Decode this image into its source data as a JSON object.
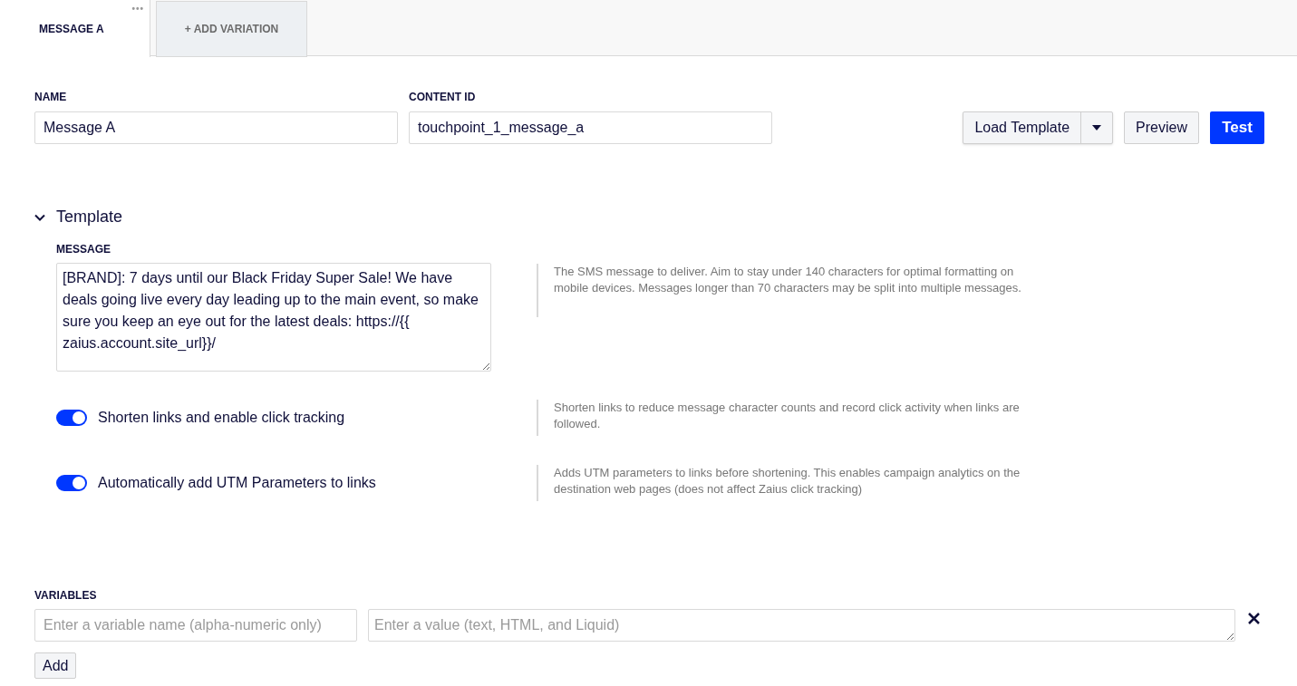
{
  "tabs": [
    {
      "label": "MESSAGE A",
      "selected": true,
      "menu": "•••"
    },
    {
      "label": "+ ADD VARIATION",
      "selected": false
    }
  ],
  "fields": [
    {
      "label": "NAME",
      "value": "Message A"
    },
    {
      "label": "CONTENT ID",
      "value": "touchpoint_1_message_a"
    }
  ],
  "actions": {
    "load_template": "Load Template",
    "preview": "Preview",
    "test": "Test"
  },
  "template": {
    "title": "Template",
    "expanded": true,
    "message_label": "MESSAGE",
    "message": "[BRAND]: 7 days until our Black Friday Super Sale! We have deals going live every day leading up to the main event, so make sure you keep an eye out for the latest deals: https://{{ zaius.account.site_url}}/",
    "message_help": "The SMS message to deliver. Aim to stay under 140 characters for optimal formatting on mobile devices. Messages longer than 70 characters may be split into multiple messages.",
    "toggles": [
      {
        "label": "Shorten links and enable click tracking",
        "on": true,
        "help": "Shorten links to reduce message character counts and record click activity when links are followed."
      },
      {
        "label": "Automatically add UTM Parameters to links",
        "on": true,
        "help": "Adds UTM parameters to links before shortening. This enables campaign analytics on the destination web pages (does not affect Zaius click tracking)"
      }
    ]
  },
  "variables": {
    "label": "VARIABLES",
    "name_placeholder": "Enter a variable name (alpha-numeric only)",
    "value_placeholder": "Enter a value (text, HTML, and Liquid)",
    "add": "Add"
  }
}
